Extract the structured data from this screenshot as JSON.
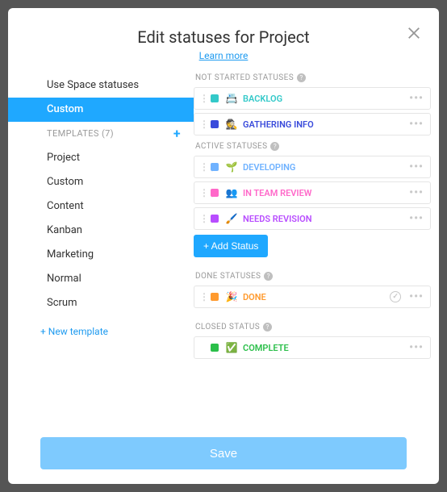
{
  "header": {
    "title": "Edit statuses for Project",
    "learn_more": "Learn more"
  },
  "left": {
    "use_space": "Use Space statuses",
    "custom": "Custom",
    "templates_header": "TEMPLATES (7)",
    "templates": [
      "Project",
      "Custom",
      "Content",
      "Kanban",
      "Marketing",
      "Normal",
      "Scrum"
    ],
    "new_template": "+ New template"
  },
  "sections": {
    "not_started": {
      "label": "NOT STARTED STATUSES",
      "items": [
        {
          "color": "#33c9c9",
          "emoji": "📇",
          "label": "BACKLOG",
          "label_color": "#33c9c9"
        },
        {
          "color": "#3a4bdb",
          "emoji": "🕵️",
          "label": "GATHERING INFO",
          "label_color": "#3a4bdb"
        }
      ]
    },
    "active": {
      "label": "ACTIVE STATUSES",
      "items": [
        {
          "color": "#6fb2ff",
          "emoji": "🌱",
          "label": "DEVELOPING",
          "label_color": "#6fb2ff"
        },
        {
          "color": "#ff68c9",
          "emoji": "👥",
          "label": "IN TEAM REVIEW",
          "label_color": "#ff68c9"
        },
        {
          "color": "#b84dff",
          "emoji": "🖌️",
          "label": "NEEDS REVISION",
          "label_color": "#b84dff"
        }
      ],
      "add_btn": "+ Add Status"
    },
    "done": {
      "label": "DONE STATUSES",
      "items": [
        {
          "color": "#ff9a2e",
          "emoji": "🎉",
          "label": "DONE",
          "label_color": "#ff9a2e"
        }
      ]
    },
    "closed": {
      "label": "CLOSED STATUS",
      "items": [
        {
          "color": "#2bbf4a",
          "emoji": "✅",
          "label": "COMPLETE",
          "label_color": "#2bbf4a"
        }
      ]
    }
  },
  "footer": {
    "save": "Save"
  }
}
